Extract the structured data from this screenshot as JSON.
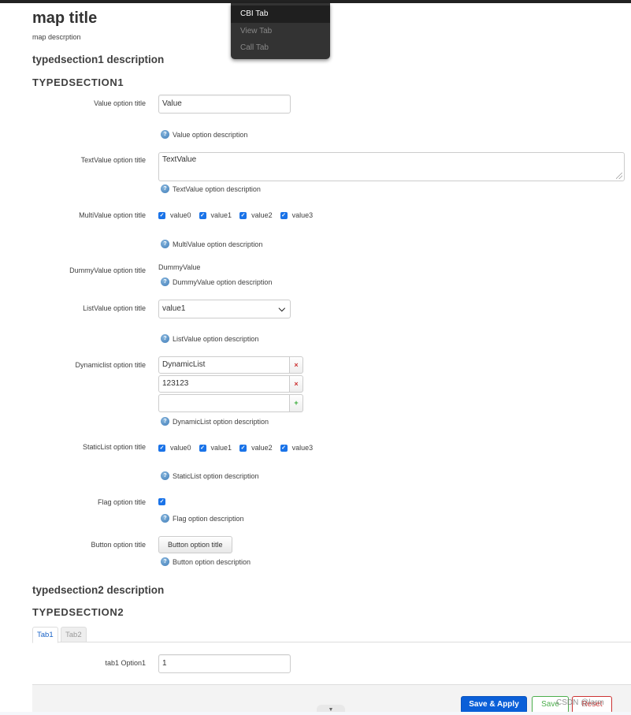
{
  "topbar": {
    "tab_menu": [
      {
        "label": "CBI Tab",
        "active": true
      },
      {
        "label": "View Tab",
        "active": false
      },
      {
        "label": "Call Tab",
        "active": false
      }
    ]
  },
  "map": {
    "title": "map title",
    "description": "map descrption"
  },
  "section1": {
    "description": "typedsection1 description",
    "title": "TYPEDSECTION1",
    "options": {
      "value": {
        "label": "Value option title",
        "value": "Value",
        "description": "Value option description"
      },
      "textvalue": {
        "label": "TextValue option title",
        "value": "TextValue",
        "description": "TextValue option description"
      },
      "multivalue": {
        "label": "MultiValue option title",
        "choices": [
          {
            "label": "value0",
            "checked": true
          },
          {
            "label": "value1",
            "checked": true
          },
          {
            "label": "value2",
            "checked": true
          },
          {
            "label": "value3",
            "checked": true
          }
        ],
        "description": "MultiValue option description"
      },
      "dummyvalue": {
        "label": "DummyValue option title",
        "value": "DummyValue",
        "description": "DummyValue option description"
      },
      "listvalue": {
        "label": "ListValue option title",
        "selected": "value1",
        "description": "ListValue option description"
      },
      "dynamiclist": {
        "label": "Dynamiclist option title",
        "entries": [
          "DynamicList",
          "123123"
        ],
        "new_entry": "",
        "remove_glyph": "×",
        "add_glyph": "+",
        "description": "DynamicList option description"
      },
      "staticlist": {
        "label": "StaticList option title",
        "choices": [
          {
            "label": "value0",
            "checked": true
          },
          {
            "label": "value1",
            "checked": true
          },
          {
            "label": "value2",
            "checked": true
          },
          {
            "label": "value3",
            "checked": true
          }
        ],
        "description": "StaticList option description"
      },
      "flag": {
        "label": "Flag option title",
        "checked": true,
        "description": "Flag option description"
      },
      "button": {
        "label": "Button option title",
        "button_label": "Button option title",
        "description": "Button option description"
      }
    }
  },
  "section2": {
    "description": "typedsection2 description",
    "title": "TYPEDSECTION2",
    "tabs": [
      {
        "label": "Tab1",
        "active": true
      },
      {
        "label": "Tab2",
        "active": false
      }
    ],
    "tab1_option1": {
      "label": "tab1 Option1",
      "value": "1"
    }
  },
  "actions": {
    "save_apply": "Save & Apply",
    "save": "Save",
    "reset": "Reset",
    "collapse_glyph": "▼"
  },
  "icons": {
    "help": "?",
    "check": "✓",
    "chevron": "⌄"
  },
  "watermark": "CSDN @larm",
  "colors": {
    "primary": "#0a5fd8",
    "save": "#4cae4c",
    "reset": "#cc3333",
    "checkbox": "#1a73e8",
    "tab_active": "#1a63c7"
  }
}
